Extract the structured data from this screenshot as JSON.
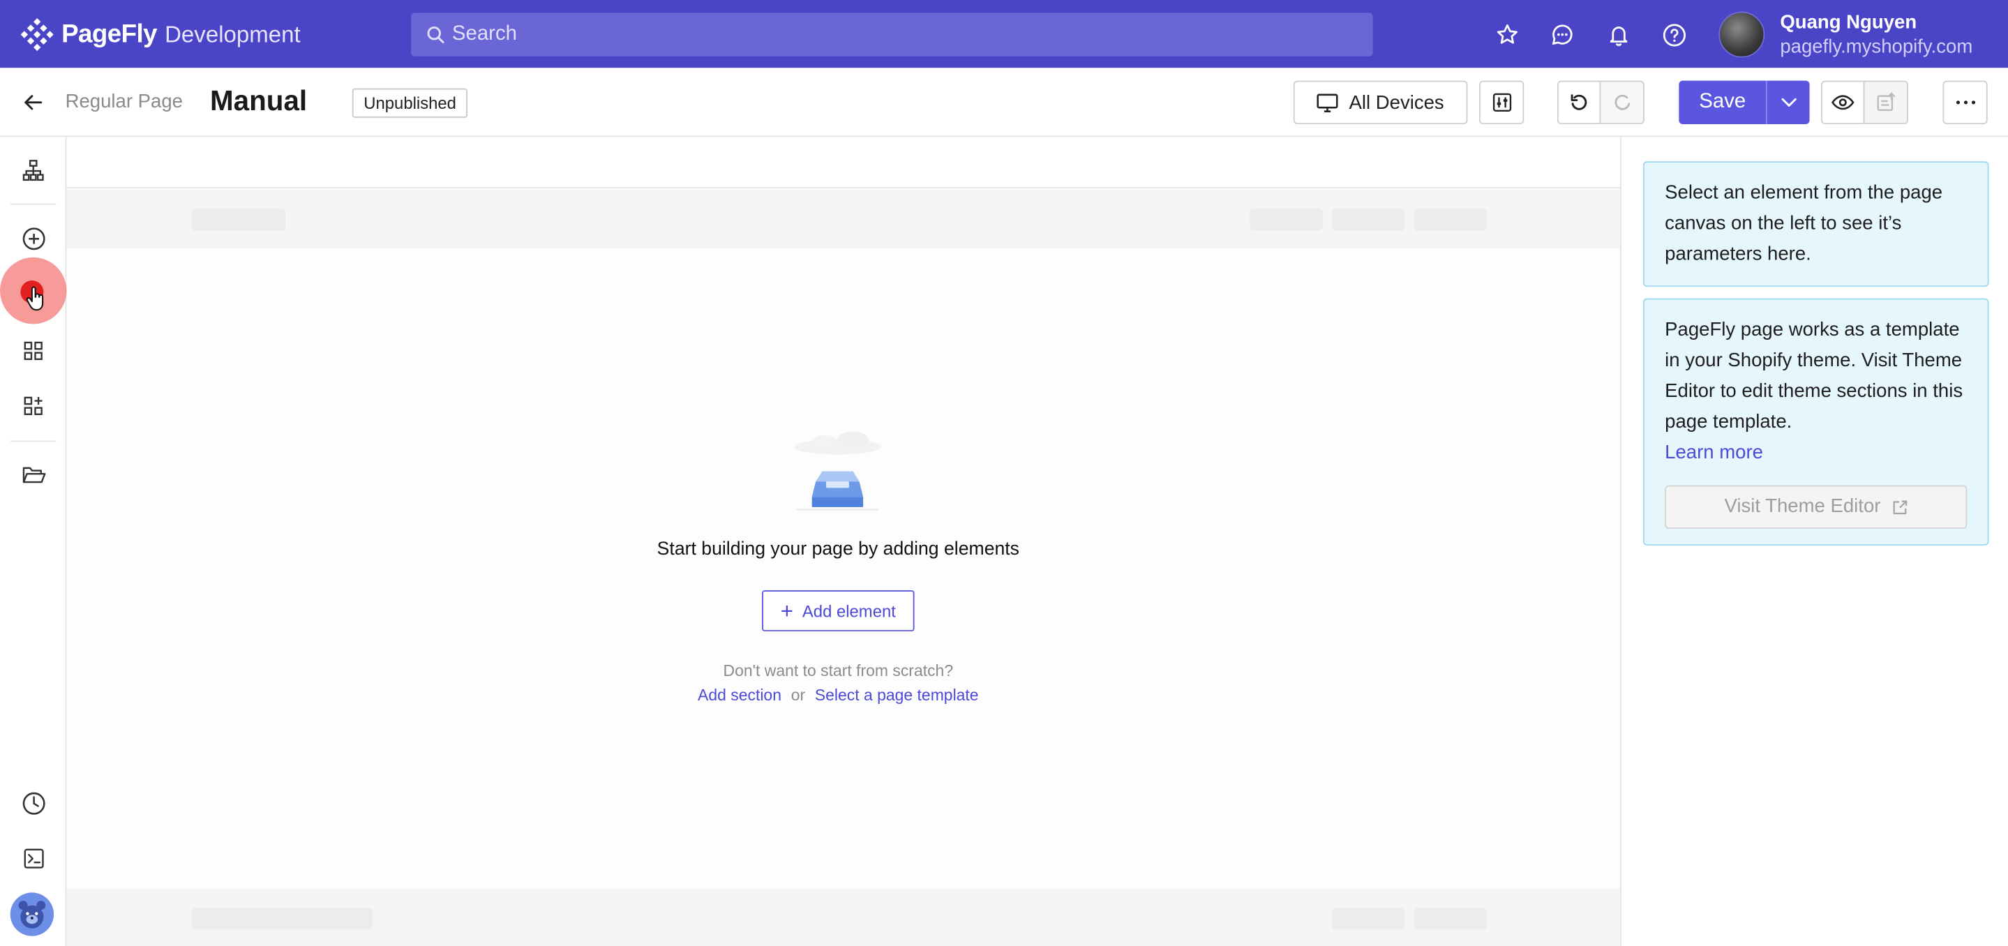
{
  "app": {
    "brand": "PageFly",
    "store": "Development",
    "search_placeholder": "Search",
    "user": {
      "name": "Quang Nguyen",
      "shop": "pagefly.myshopify.com"
    },
    "top_icons": [
      "star-icon",
      "chat-icon",
      "bell-icon",
      "help-icon"
    ]
  },
  "toolbar": {
    "breadcrumb": "Regular Page",
    "title": "Manual",
    "status": "Unpublished",
    "devices_label": "All Devices",
    "save_label": "Save"
  },
  "sidebar": {
    "items": [
      "page-structure-icon",
      "add-icon",
      "record-icon",
      "grid-icon",
      "add-block-icon",
      "folder-icon",
      "history-icon",
      "console-icon"
    ]
  },
  "canvas": {
    "empty_title": "Start building your page by adding elements",
    "add_element_label": "Add element",
    "scratch_text": "Don't want to start from scratch?",
    "add_section_link": "Add section",
    "or_text": "or",
    "template_link": "Select a page template"
  },
  "panel": {
    "select_hint": "Select an element from the page canvas on the left to see it’s parameters here.",
    "theme_note": "PageFly page works as a template in your Shopify theme. Visit Theme Editor to edit theme sections in this page template.",
    "learn_more": "Learn more",
    "visit_theme_editor": "Visit Theme Editor"
  },
  "colors": {
    "topbar": "#4a44c6",
    "accent": "#5a56e0",
    "info_bg": "#e6f6fd",
    "cursor_highlight": "#f47878"
  }
}
